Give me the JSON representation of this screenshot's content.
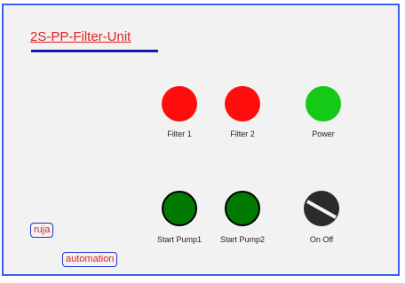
{
  "panel": {
    "title": "2S-PP-Filter-Unit"
  },
  "indicators": [
    {
      "label": "Filter 1",
      "state": "red",
      "color": "#ff0d0d"
    },
    {
      "label": "Filter 2",
      "state": "red",
      "color": "#ff0d0d"
    },
    {
      "label": "Power",
      "state": "green",
      "color": "#16c916"
    }
  ],
  "controls": [
    {
      "label": "Start Pump1",
      "color": "#007a00"
    },
    {
      "label": "Start Pump2",
      "color": "#007a00"
    },
    {
      "label": "On Off",
      "type": "rotary-switch"
    }
  ],
  "branding": {
    "line1": "ruja",
    "line2": "automation"
  },
  "colors": {
    "frame_border": "#3b5ff0",
    "title_text": "#e02020",
    "title_underline": "#1a1aa8"
  }
}
